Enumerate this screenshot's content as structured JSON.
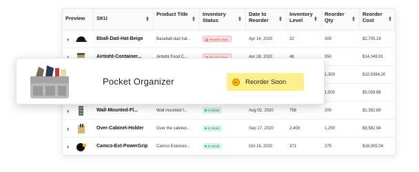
{
  "table": {
    "columns": [
      {
        "label": "Preview",
        "sortable": false
      },
      {
        "label": "SKU",
        "sortable": true
      },
      {
        "label": "Product Title",
        "sortable": true
      },
      {
        "label": "Inventory Status",
        "sortable": true
      },
      {
        "label": "Date to Reorder",
        "sortable": true
      },
      {
        "label": "Inventory Level",
        "sortable": true
      },
      {
        "label": "Reorder Qty",
        "sortable": true
      },
      {
        "label": "Reorder Cost",
        "sortable": true
      }
    ],
    "rows": [
      {
        "sku": "Bball-Dad-Hat-Beige",
        "title": "Baseball dad hat...",
        "status": "Reorder Now",
        "status_type": "reorder",
        "date": "Apr 14, 2020",
        "level": "22",
        "qty": "300",
        "cost": "$2,700.19",
        "icon": "cap-icon"
      },
      {
        "sku": "Airtight-Container...",
        "title": "Airtight Food C...",
        "status": "Reorder Now",
        "status_type": "reorder",
        "date": "Apr 28, 2020",
        "level": "48",
        "qty": "550",
        "cost": "$14,049.91",
        "icon": "container-icon"
      },
      {
        "sku": "",
        "title": "",
        "status": "",
        "status_type": "",
        "date": "",
        "level": "",
        "qty": "1,300",
        "cost": "$10,0394.20",
        "icon": ""
      },
      {
        "sku": "",
        "title": "",
        "status": "",
        "status_type": "",
        "date": "",
        "level": "",
        "qty": "1,500",
        "cost": "$5,039.88",
        "icon": ""
      },
      {
        "sku": "Wall-Mounted-Fl...",
        "title": "Wall mounted f...",
        "status": "In Stock",
        "status_type": "instock",
        "date": "Aug 02, 2020",
        "level": "758",
        "qty": "200",
        "cost": "$2,392.89",
        "icon": "wall-rack-icon"
      },
      {
        "sku": "Over-Cabinet-Holder",
        "title": "Over the cabinet...",
        "status": "In Stock",
        "status_type": "instock",
        "date": "Sep 17, 2020",
        "level": "2,409",
        "qty": "1,250",
        "cost": "$9,582.94",
        "icon": "cabinet-holder-icon"
      },
      {
        "sku": "Camco-Ext-PowerGrip",
        "title": "Camco Extensio...",
        "status": "In Stock",
        "status_type": "instock",
        "date": "Oct 16, 2020",
        "level": "371",
        "qty": "275",
        "cost": "$18,305.04",
        "icon": "power-cord-icon"
      }
    ]
  },
  "overlay": {
    "product_name": "Pocket Organizer",
    "status_label": "Reorder Soon",
    "status_color": "#fdf08a",
    "icon": "organizer-icon"
  },
  "colors": {
    "reorder_badge": "#fde4e4",
    "instock_badge": "#d7f5e6"
  }
}
